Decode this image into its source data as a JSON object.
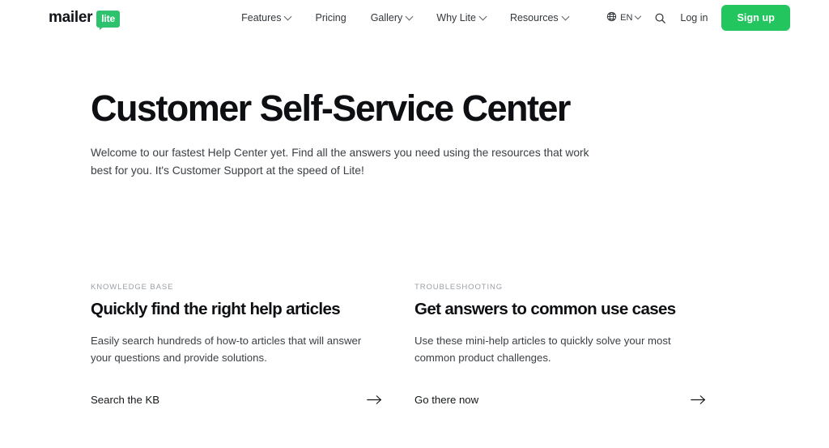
{
  "brand": {
    "logo_word": "mailer",
    "logo_badge": "lite",
    "accent_green": "#2fc26e",
    "button_green": "#22c55e"
  },
  "header": {
    "nav": [
      {
        "label": "Features",
        "has_dropdown": true
      },
      {
        "label": "Pricing",
        "has_dropdown": false
      },
      {
        "label": "Gallery",
        "has_dropdown": true
      },
      {
        "label": "Why Lite",
        "has_dropdown": true
      },
      {
        "label": "Resources",
        "has_dropdown": true
      }
    ],
    "language": {
      "icon": "globe-icon",
      "value": "EN",
      "has_dropdown": true
    },
    "search_icon": "search-icon",
    "login_label": "Log in",
    "signup_label": "Sign up"
  },
  "hero": {
    "title": "Customer Self-Service Center",
    "subtitle": "Welcome to our fastest Help Center yet. Find all the answers you need using the resources that work best for you. It's Customer Support at the speed of Lite!"
  },
  "cards": [
    {
      "eyebrow": "KNOWLEDGE BASE",
      "title": "Quickly find the right help articles",
      "text": "Easily search hundreds of how-to articles that will answer your questions and provide solutions.",
      "link_label": "Search the KB",
      "link_icon": "arrow-right-icon"
    },
    {
      "eyebrow": "TROUBLESHOOTING",
      "title": "Get answers to common use cases",
      "text": "Use these mini-help articles to quickly solve your most common product challenges.",
      "link_label": "Go there now",
      "link_icon": "arrow-right-icon"
    }
  ]
}
